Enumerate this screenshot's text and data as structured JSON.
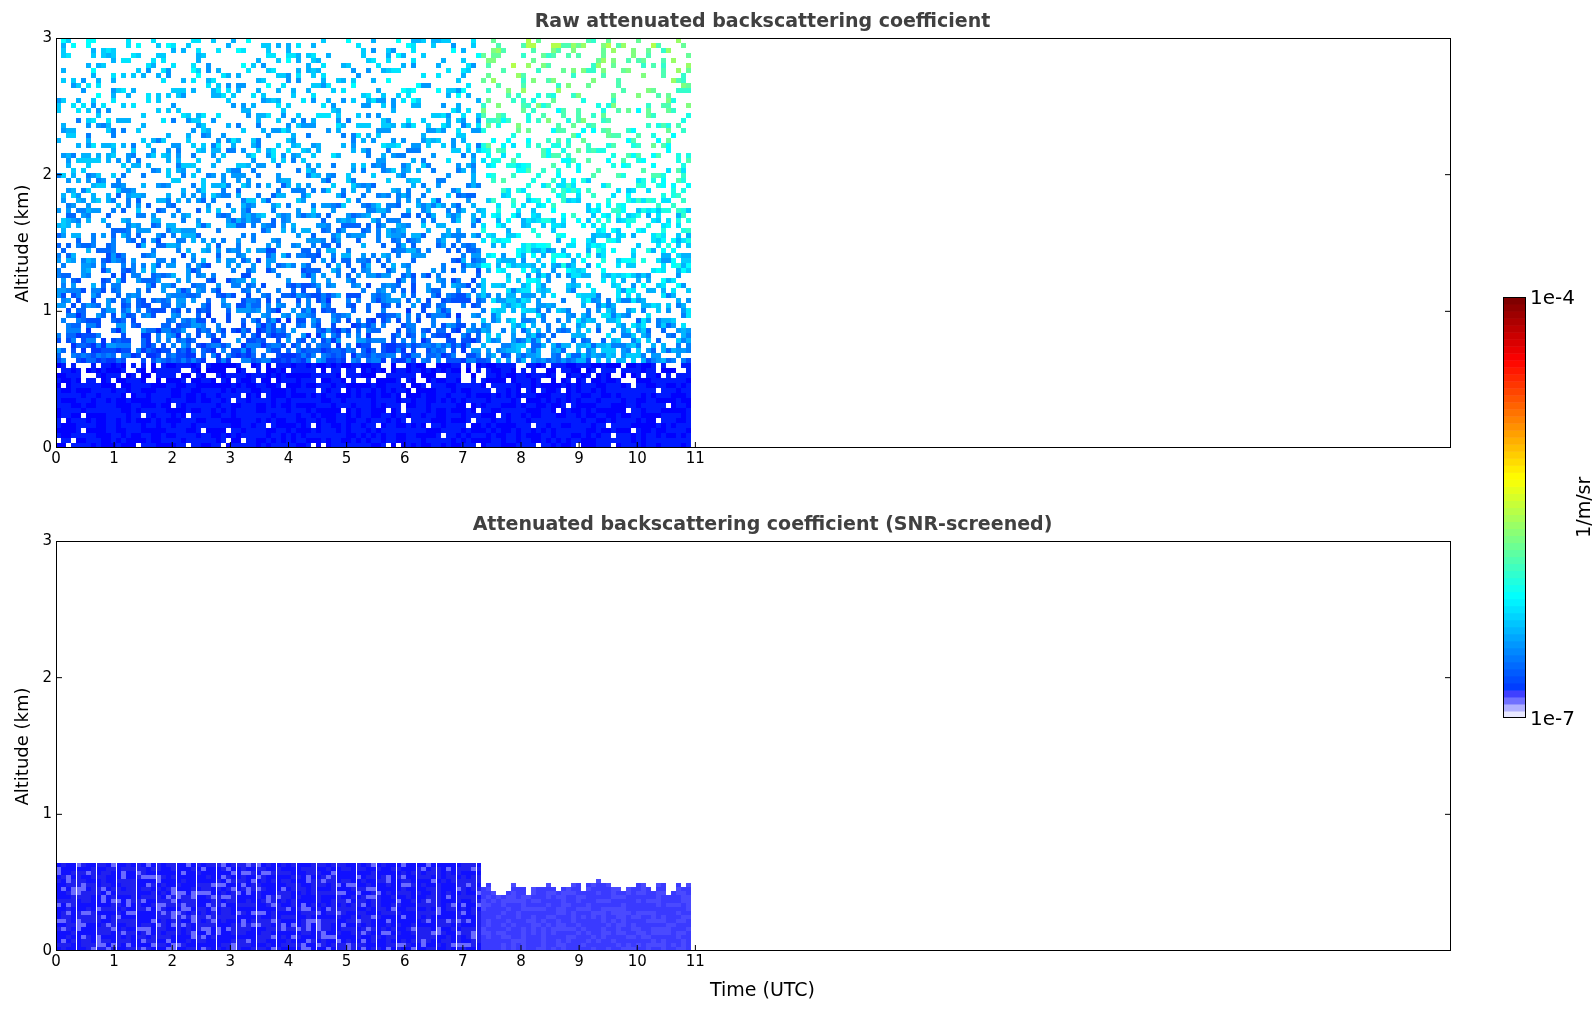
{
  "plots": [
    {
      "kind": "raw",
      "title": "Raw attenuated backscattering coefficient",
      "ylabel": "Altitude (km)",
      "yticks": [
        "3",
        "2",
        "1",
        "0"
      ],
      "xticks": [
        "0",
        "1",
        "2",
        "3",
        "4",
        "5",
        "6",
        "7",
        "8",
        "9",
        "10",
        "11"
      ]
    },
    {
      "kind": "screened",
      "title": "Attenuated backscattering coefficient (SNR-screened)",
      "ylabel": "Altitude (km)",
      "yticks": [
        "3",
        "2",
        "1",
        "0"
      ],
      "xticks": [
        "0",
        "1",
        "2",
        "3",
        "4",
        "5",
        "6",
        "7",
        "8",
        "9",
        "10",
        "11"
      ],
      "xlabel": "Time (UTC)"
    }
  ],
  "colorbar": {
    "max_label": "1e-4",
    "min_label": "1e-7",
    "label": "1/m/sr"
  }
}
